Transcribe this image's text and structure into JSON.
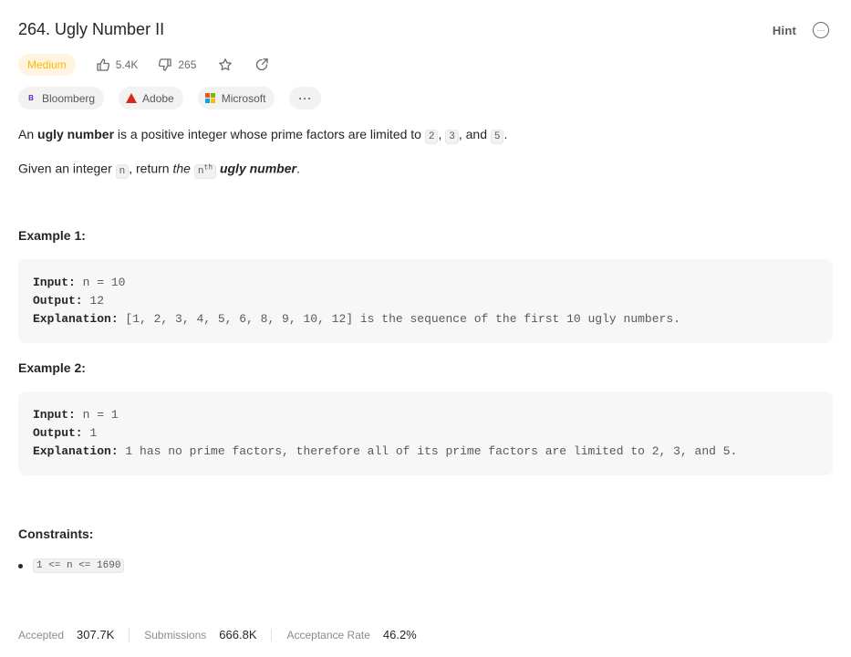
{
  "problem": {
    "title": "264. Ugly Number II",
    "difficulty": "Medium",
    "likes": "5.4K",
    "dislikes": "265"
  },
  "toolbar": {
    "hint_label": "Hint",
    "more_label": "···"
  },
  "tags": [
    {
      "name": "Bloomberg"
    },
    {
      "name": "Adobe"
    },
    {
      "name": "Microsoft"
    }
  ],
  "tags_more_label": "···",
  "description": {
    "p1_prefix": "An ",
    "p1_bold": "ugly number",
    "p1_middle": " is a positive integer whose prime factors are limited to ",
    "code_2": "2",
    "sep1": ", ",
    "code_3": "3",
    "sep2": ", and ",
    "code_5": "5",
    "end": ".",
    "p2_prefix": "Given an integer ",
    "code_n": "n",
    "p2_middle": ", return ",
    "p2_italic": "the",
    "code_nth": "n",
    "code_nth_sup": "th",
    "p2_bold_italic": "ugly number",
    "p2_end": "."
  },
  "examples": [
    {
      "title": "Example 1:",
      "input_label": "Input:",
      "input": " n = 10",
      "output_label": "Output:",
      "output": " 12",
      "explanation_label": "Explanation:",
      "explanation": " [1, 2, 3, 4, 5, 6, 8, 9, 10, 12] is the sequence of the first 10 ugly numbers."
    },
    {
      "title": "Example 2:",
      "input_label": "Input:",
      "input": " n = 1",
      "output_label": "Output:",
      "output": " 1",
      "explanation_label": "Explanation:",
      "explanation": " 1 has no prime factors, therefore all of its prime factors are limited to 2, 3, and 5."
    }
  ],
  "constraints": {
    "title": "Constraints:",
    "items": [
      "1 <= n <= 1690"
    ]
  },
  "stats": {
    "accepted_label": "Accepted",
    "accepted": "307.7K",
    "submissions_label": "Submissions",
    "submissions": "666.8K",
    "acceptance_label": "Acceptance Rate",
    "acceptance": "46.2%"
  },
  "colors": {
    "medium": "#ffb800",
    "medium_bg": "#fff4e0",
    "code_bg": "#f7f7f8"
  }
}
